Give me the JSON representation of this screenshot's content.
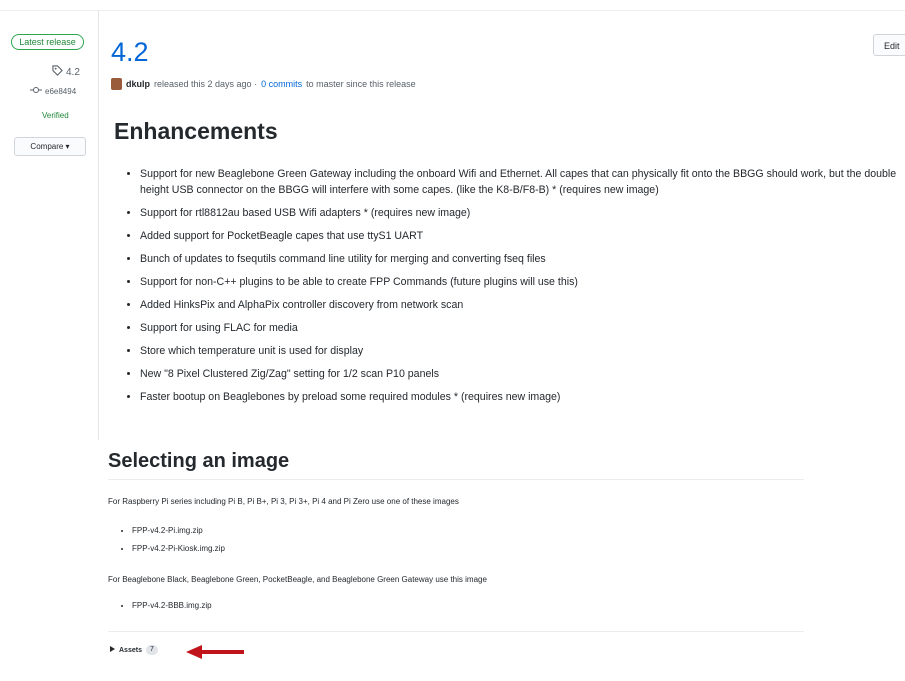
{
  "sidebar": {
    "latest_badge": "Latest release",
    "tag": "4.2",
    "commit": "e6e8494",
    "verified": "Verified",
    "compare": "Compare ▾"
  },
  "header": {
    "version": "4.2",
    "edit": "Edit",
    "user": "dkulp",
    "released_text": "released this 2 days ago ·",
    "commits_link": "0 commits",
    "commits_suffix": "to master since this release"
  },
  "enhancements": {
    "heading": "Enhancements",
    "items": [
      "Support for new Beaglebone Green Gateway including the onboard Wifi and Ethernet. All capes that can physically fit onto the BBGG should work, but the double height USB connector on the BBGG will interfere with some capes. (like the K8-B/F8-B) * (requires new image)",
      "Support for rtl8812au based USB Wifi adapters * (requires new image)",
      "Added support for PocketBeagle capes that use ttyS1 UART",
      "Bunch of updates to fsequtils command line utility for merging and converting fseq files",
      "Support for non-C++ plugins to be able to create FPP Commands (future plugins will use this)",
      "Added HinksPix and AlphaPix controller discovery from network scan",
      "Support for using FLAC for media",
      "Store which temperature unit is used for display",
      "New \"8 Pixel Clustered Zig/Zag\" setting for 1/2 scan P10 panels",
      "Faster bootup on Beaglebones by preload some required modules * (requires new image)"
    ]
  },
  "selecting": {
    "heading": "Selecting an image",
    "pi_text": "For Raspberry Pi series including Pi B, Pi B+, Pi 3, Pi 3+, Pi 4 and Pi Zero use one of these images",
    "pi_files": [
      "FPP-v4.2-Pi.img.zip",
      "FPP-v4.2-Pi-Kiosk.img.zip"
    ],
    "bb_text": "For Beaglebone Black, Beaglebone Green, PocketBeagle, and Beaglebone Green Gateway use this image",
    "bb_files": [
      "FPP-v4.2-BBB.img.zip"
    ]
  },
  "assets": {
    "label": "Assets",
    "count": "7"
  },
  "colors": {
    "link": "#0366d6",
    "verified": "#22863a",
    "arrow": "#c0141a"
  },
  "icons": [
    "tag-icon",
    "commit-icon",
    "triangle-right-icon",
    "red-arrow-icon"
  ]
}
